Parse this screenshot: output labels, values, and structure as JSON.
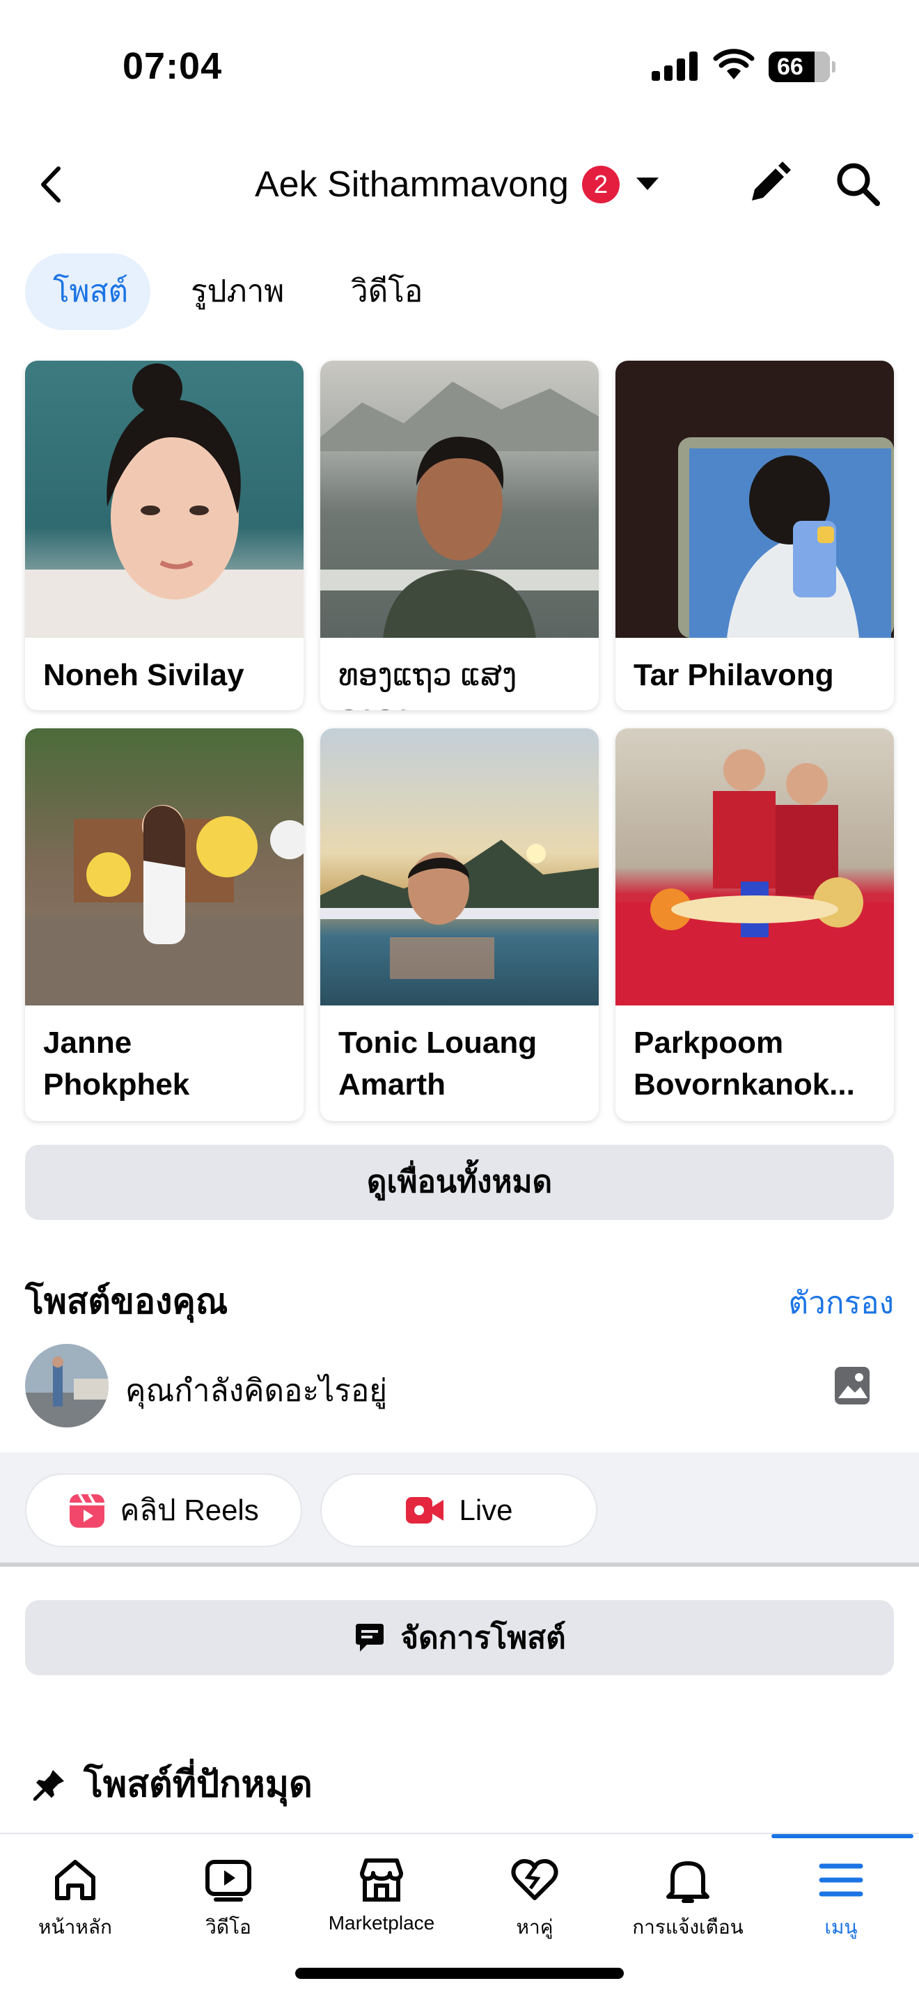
{
  "status_bar": {
    "time": "07:04",
    "battery": "66"
  },
  "header": {
    "title": "Aek Sithammavong",
    "badge_count": "2"
  },
  "tabs": [
    {
      "label": "โพสต์",
      "active": true
    },
    {
      "label": "รูปภาพ",
      "active": false
    },
    {
      "label": "วิดีโอ",
      "active": false
    }
  ],
  "friends": [
    {
      "name": "Noneh Sivilay"
    },
    {
      "name": "ທອງແຖວ ແສງດາລາ"
    },
    {
      "name": "Tar Philavong"
    },
    {
      "name": "Janne Phokphek"
    },
    {
      "name": "Tonic Louang Amarth"
    },
    {
      "name": "Parkpoom Bovornkanok..."
    }
  ],
  "see_all_label": "ดูเพื่อนทั้งหมด",
  "your_posts": {
    "title": "โพสต์ของคุณ",
    "filter_label": "ตัวกรอง",
    "composer_placeholder": "คุณกำลังคิดอะไรอยู่"
  },
  "actions": {
    "reels_label": "คลิป Reels",
    "live_label": "Live"
  },
  "manage_posts_label": "จัดการโพสต์",
  "pinned_title": "โพสต์ที่ปักหมุด",
  "nav": [
    {
      "label": "หน้าหลัก",
      "icon": "home-icon"
    },
    {
      "label": "วิดีโอ",
      "icon": "video-icon"
    },
    {
      "label": "Marketplace",
      "icon": "marketplace-icon"
    },
    {
      "label": "หาคู่",
      "icon": "dating-icon"
    },
    {
      "label": "การแจ้งเตือน",
      "icon": "bell-icon"
    },
    {
      "label": "เมนู",
      "icon": "menu-icon",
      "active": true
    }
  ],
  "colors": {
    "accent": "#1b74e4",
    "badge": "#e41e3f",
    "button_gray": "#e4e6eb"
  }
}
